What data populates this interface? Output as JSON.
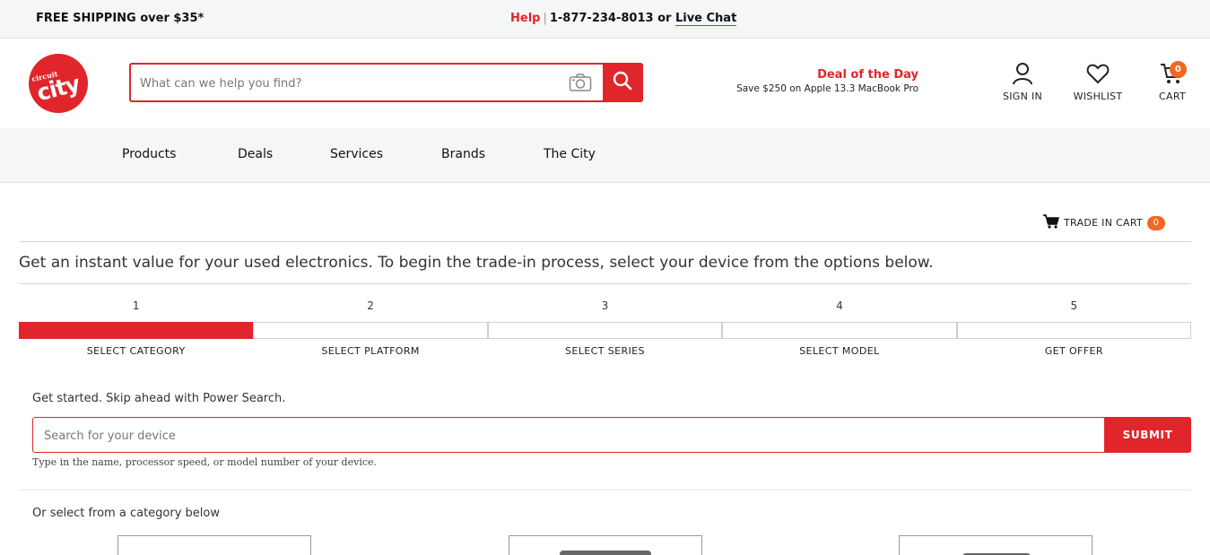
{
  "topbar": {
    "shipping": "FREE SHIPPING over $35*",
    "help": "Help",
    "separator": "|",
    "phone": "1-877-234-8013 or",
    "live_chat": "Live Chat"
  },
  "header": {
    "logo_small": "circuit",
    "logo_big": "city",
    "search_placeholder": "What can we help you find?",
    "deal_title": "Deal of the Day",
    "deal_text": "Save $250 on Apple 13.3 MacBook Pro",
    "sign_in": "SIGN IN",
    "wishlist": "WISHLIST",
    "cart": "CART",
    "cart_count": "0"
  },
  "nav": {
    "items": [
      "Products",
      "Deals",
      "Services",
      "Brands",
      "The City"
    ]
  },
  "trade": {
    "cart_label": "TRADE IN CART",
    "cart_count": "0",
    "intro": "Get an instant value for your used electronics. To begin the trade-in process, select your device from the options below.",
    "steps": [
      {
        "num": "1",
        "label": "SELECT CATEGORY",
        "active": true
      },
      {
        "num": "2",
        "label": "SELECT PLATFORM",
        "active": false
      },
      {
        "num": "3",
        "label": "SELECT SERIES",
        "active": false
      },
      {
        "num": "4",
        "label": "SELECT MODEL",
        "active": false
      },
      {
        "num": "5",
        "label": "GET OFFER",
        "active": false
      }
    ],
    "get_started": "Get started. Skip ahead with Power Search.",
    "power_search_placeholder": "Search for your device",
    "submit": "SUBMIT",
    "hint": "Type in the name, processor speed, or model number of your device.",
    "or_select": "Or select from a category below"
  },
  "colors": {
    "brand_red": "#e0262b",
    "badge_orange": "#f26722"
  }
}
